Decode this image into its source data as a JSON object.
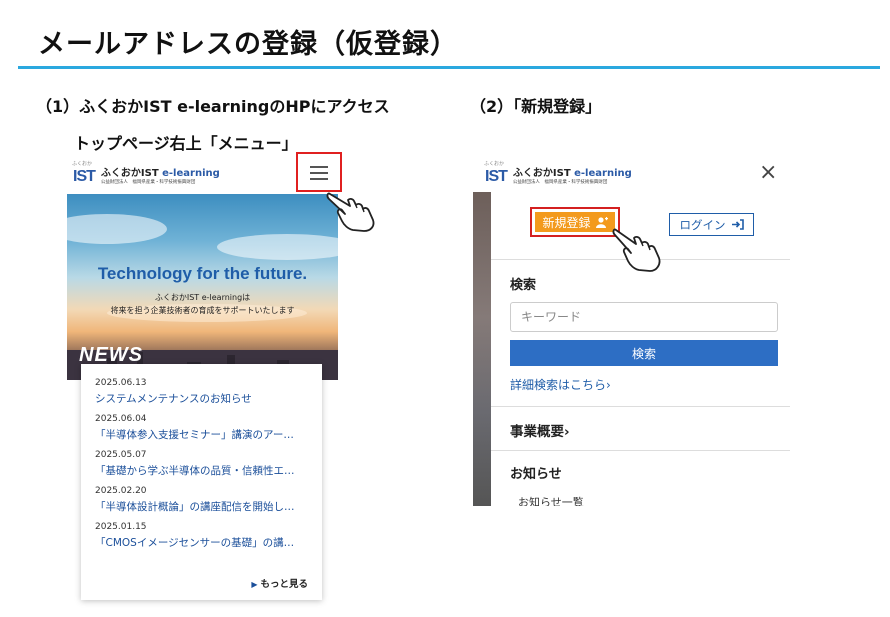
{
  "title": "メールアドレスの登録（仮登録）",
  "steps": {
    "step1": "（1）ふくおかIST e-learningのHPにアクセス",
    "step1_sub": "トップページ右上「メニュー」",
    "step2": "（2）「新規登録」"
  },
  "site": {
    "logo_mark": "IST",
    "logo_small": "ふくおか",
    "logo_name_jp": "ふくおかIST",
    "logo_name_en": "e-learning",
    "logo_sub": "公益財団法人　福岡県産業・科学技術振興財団"
  },
  "hero": {
    "headline": "Technology for the future.",
    "sub1": "ふくおかIST e-learningは",
    "sub2": "将来を担う企業技術者の育成をサポートいたします",
    "news_label": "NEWS"
  },
  "news": [
    {
      "date": "2025.06.13",
      "text": "システムメンテナンスのお知らせ"
    },
    {
      "date": "2025.06.04",
      "text": "「半導体参入支援セミナー」講演のアー…"
    },
    {
      "date": "2025.05.07",
      "text": "「基礎から学ぶ半導体の品質・信頼性エ…"
    },
    {
      "date": "2025.02.20",
      "text": "「半導体設計概論」の講座配信を開始し…"
    },
    {
      "date": "2025.01.15",
      "text": "「CMOSイメージセンサーの基礎」の講…"
    }
  ],
  "more_label": "もっと見る",
  "menu": {
    "register_label": "新規登録",
    "login_label": "ログイン",
    "search_heading": "検索",
    "search_placeholder": "キーワード",
    "search_button": "検索",
    "advanced_link": "詳細検索はこちら",
    "business_link": "事業概要",
    "notice_heading": "お知らせ",
    "notice_list_link": "お知らせ一覧"
  },
  "colors": {
    "accent_rule": "#2aa8df",
    "brand_blue": "#1f5da8",
    "register_orange": "#f39a1d",
    "highlight_red": "#e02020"
  },
  "icons": [
    "menu-icon",
    "hand-pointer-icon",
    "close-icon",
    "user-icon",
    "login-icon",
    "chevron-right-icon",
    "triangle-right-icon"
  ]
}
